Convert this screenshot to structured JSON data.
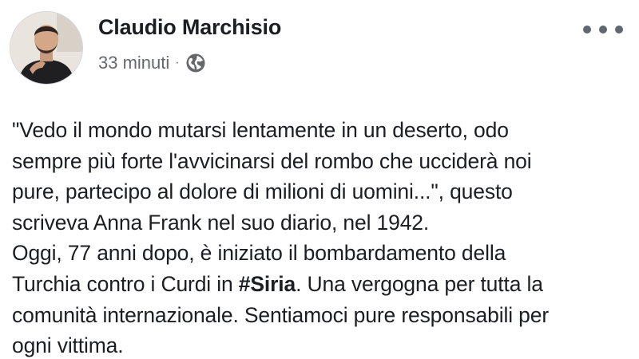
{
  "post": {
    "author": {
      "name": "Claudio Marchisio",
      "avatar": "profile-photo"
    },
    "timestamp": "33 minuti",
    "separator": "·",
    "privacy_icon": "globe-icon",
    "more_icon": "more-options-icon",
    "body_lines": [
      "\"Vedo il mondo mutarsi lentamente in un deserto, odo",
      "sempre più forte l'avvicinarsi del rombo che ucciderà noi",
      "pure, partecipo al dolore di milioni di uomini...\", questo",
      "scriveva Anna Frank nel suo diario, nel 1942.",
      "Oggi, 77 anni dopo, è iniziato il bombardamento della"
    ],
    "line6_before": "Turchia contro i Curdi in ",
    "hashtag": "#Siria",
    "line6_after": ". Una vergogna per tutta la",
    "body_lines_end": [
      "comunità internazionale. Sentiamoci pure responsabili per",
      "ogni vittima."
    ]
  },
  "colors": {
    "text": "#1c1e21",
    "meta": "#65676b",
    "background": "#ffffff"
  }
}
